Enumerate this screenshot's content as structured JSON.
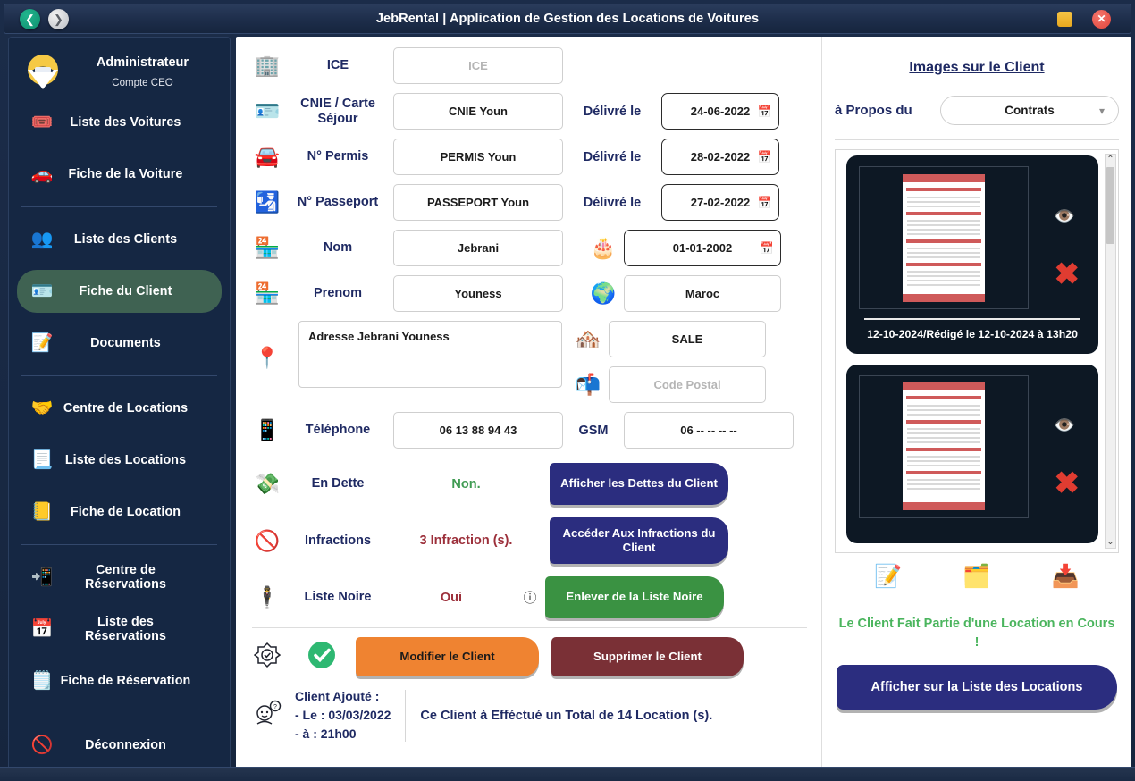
{
  "window": {
    "title": "JebRental | Application de Gestion des Locations de Voitures",
    "back_icon": "arrow-left-icon",
    "forward_icon": "arrow-right-icon",
    "minimize_label": "",
    "close_label": "✕"
  },
  "sidebar": {
    "profile": {
      "name": "Administrateur",
      "role": "Compte CEO",
      "avatar_icon": "user-avatar-icon"
    },
    "items": [
      {
        "label": "Liste des Voitures",
        "icon": "🎟️",
        "icon_name": "car-list-icon",
        "active": false
      },
      {
        "label": "Fiche de la Voiture",
        "icon": "🚗",
        "icon_name": "car-sheet-icon",
        "active": false
      },
      {
        "label": "Liste des Clients",
        "icon": "👥",
        "icon_name": "clients-list-icon",
        "active": false
      },
      {
        "label": "Fiche du Client",
        "icon": "🪪",
        "icon_name": "client-sheet-icon",
        "active": true
      },
      {
        "label": "Documents",
        "icon": "📝",
        "icon_name": "documents-icon",
        "active": false
      },
      {
        "label": "Centre de Locations",
        "icon": "🤝",
        "icon_name": "rental-center-icon",
        "active": false
      },
      {
        "label": "Liste des Locations",
        "icon": "📃",
        "icon_name": "rentals-list-icon",
        "active": false
      },
      {
        "label": "Fiche de Location",
        "icon": "📒",
        "icon_name": "rental-sheet-icon",
        "active": false
      },
      {
        "label": "Centre de Réservations",
        "icon": "📲",
        "icon_name": "reservation-center-icon",
        "active": false
      },
      {
        "label": "Liste des Réservations",
        "icon": "📅",
        "icon_name": "reservations-list-icon",
        "active": false
      },
      {
        "label": "Fiche de Réservation",
        "icon": "🗒️",
        "icon_name": "reservation-sheet-icon",
        "active": false
      },
      {
        "label": "Déconnexion",
        "icon": "🚫",
        "icon_name": "logout-icon",
        "active": false
      }
    ]
  },
  "form": {
    "ice": {
      "label": "ICE",
      "icon": "🏢",
      "value": "",
      "placeholder": "ICE"
    },
    "cnie": {
      "label": "CNIE / Carte Séjour",
      "icon": "🪪",
      "value": "CNIE Youn",
      "delivered_label": "Délivré le",
      "date": "24-06-2022"
    },
    "permis": {
      "label": "N° Permis",
      "icon": "🚘",
      "value": "PERMIS Youn",
      "delivered_label": "Délivré le",
      "date": "28-02-2022"
    },
    "passeport": {
      "label": "N° Passeport",
      "icon": "🛂",
      "value": "PASSEPORT Youn",
      "delivered_label": "Délivré le",
      "date": "27-02-2022"
    },
    "nom": {
      "label": "Nom",
      "icon": "🏪",
      "value": "Jebrani"
    },
    "birthdate": {
      "icon": "🎂",
      "value": "01-01-2002"
    },
    "prenom": {
      "label": "Prenom",
      "icon": "🏪",
      "value": "Youness"
    },
    "pays": {
      "icon": "🌍",
      "value": "Maroc"
    },
    "adresse": {
      "icon": "📍",
      "value": "Adresse Jebrani Youness"
    },
    "ville": {
      "icon": "🏘️",
      "value": "SALE"
    },
    "code_postal": {
      "icon": "📬",
      "value": "",
      "placeholder": "Code Postal"
    },
    "telephone": {
      "label": "Téléphone",
      "icon": "📱",
      "value": "06 13 88 94 43"
    },
    "gsm": {
      "label": "GSM",
      "value": "06 -- -- -- --"
    },
    "dette": {
      "label": "En Dette",
      "icon": "💸",
      "value": "Non.",
      "button": "Afficher les Dettes du Client"
    },
    "infractions": {
      "label": "Infractions",
      "icon": "🚫",
      "value": "3 Infraction (s).",
      "button": "Accéder Aux Infractions du Client"
    },
    "liste_noire": {
      "label": "Liste Noire",
      "icon": "🕴️",
      "value": "Oui",
      "info_icon": "ⓘ",
      "button": "Enlever de la Liste Noire"
    },
    "actions": {
      "badge_icon": "🎖️",
      "check_icon": "✔",
      "modify": "Modifier le Client",
      "delete": "Supprimer le Client"
    },
    "footer": {
      "icon": "🤔",
      "added_title": "Client Ajouté :",
      "added_date": "-  Le : 03/03/2022",
      "added_time": "-  à : 21h00",
      "total": "Ce Client à Efféctué un Total de 14 Location (s)."
    }
  },
  "images_panel": {
    "title": "Images sur le Client",
    "apropos_label": "à Propos du",
    "combo_value": "Contrats",
    "combo_arrow_icon": "chevron-down-icon",
    "cards": [
      {
        "caption": "12-10-2024/Rédigé le 12-10-2024 à 13h20",
        "eye_icon": "👁️",
        "delete_icon": "✖"
      },
      {
        "caption": "",
        "eye_icon": "👁️",
        "delete_icon": "✖"
      }
    ],
    "tool_icons": [
      {
        "icon": "📝",
        "name": "signature-icon"
      },
      {
        "icon": "🗂️",
        "name": "scan-document-icon"
      },
      {
        "icon": "📥",
        "name": "import-image-icon"
      }
    ],
    "status": "Le Client Fait Partie d'une Location en Cours !",
    "show_button": "Afficher sur la Liste des Locations",
    "scroll_up_icon": "⌃",
    "scroll_down_icon": "⌄"
  },
  "colors": {
    "accent_navy": "#2b2d7f",
    "green": "#3a9242",
    "orange": "#ef8331",
    "maroon": "#7a3036",
    "sidebar_bg": "#152743",
    "active_item": "#3f6252",
    "label_navy": "#1f2a63"
  }
}
